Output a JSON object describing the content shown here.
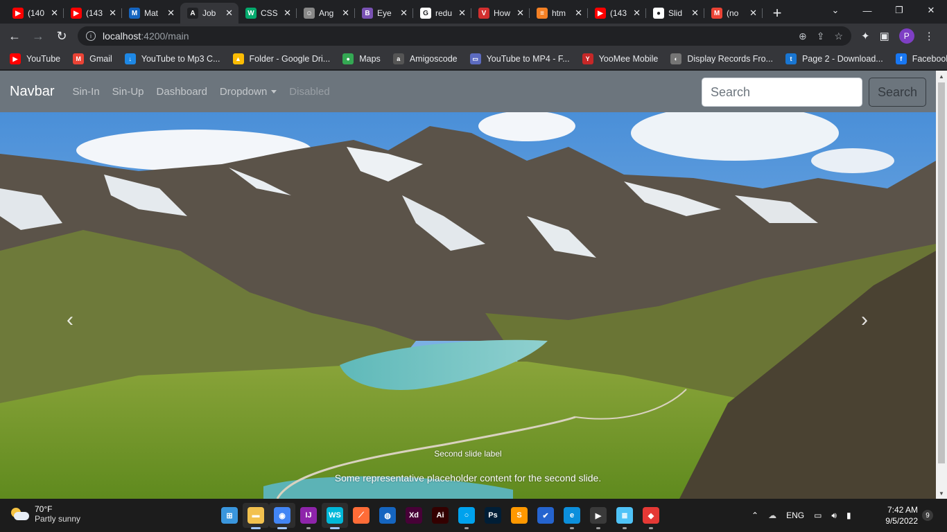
{
  "browser": {
    "tabs": [
      {
        "title": "(140",
        "icon": "youtube-icon",
        "color": "#ff0000",
        "glyph": "▶"
      },
      {
        "title": "(143",
        "icon": "youtube-icon",
        "color": "#ff0000",
        "glyph": "▶"
      },
      {
        "title": "Mat",
        "icon": "materialize-icon",
        "color": "#1565c0",
        "glyph": "M"
      },
      {
        "title": "Job",
        "icon": "angular-icon",
        "color": "#202124",
        "glyph": "A"
      },
      {
        "title": "CSS",
        "icon": "w3schools-icon",
        "color": "#04aa6d",
        "glyph": "W"
      },
      {
        "title": "Ang",
        "icon": "avatar-icon",
        "color": "#888888",
        "glyph": "☺"
      },
      {
        "title": "Eye",
        "icon": "bootstrap-icon",
        "color": "#7952b3",
        "glyph": "B"
      },
      {
        "title": "redu",
        "icon": "google-icon",
        "color": "#ffffff",
        "glyph": "G"
      },
      {
        "title": "How",
        "icon": "vivaldi-icon",
        "color": "#d32f2f",
        "glyph": "V"
      },
      {
        "title": "htm",
        "icon": "stackoverflow-icon",
        "color": "#f48024",
        "glyph": "≡"
      },
      {
        "title": "(143",
        "icon": "youtube-icon",
        "color": "#ff0000",
        "glyph": "▶"
      },
      {
        "title": "Slid",
        "icon": "github-icon",
        "color": "#ffffff",
        "glyph": "●"
      },
      {
        "title": "(no",
        "icon": "gmail-icon",
        "color": "#ea4335",
        "glyph": "M"
      }
    ],
    "active_tab": 3,
    "url_host": "localhost",
    "url_path": ":4200/main",
    "bookmarks": [
      {
        "label": "YouTube",
        "icon": "youtube-icon",
        "color": "#ff0000",
        "glyph": "▶"
      },
      {
        "label": "Gmail",
        "icon": "gmail-icon",
        "color": "#ea4335",
        "glyph": "M"
      },
      {
        "label": "YouTube to Mp3 C...",
        "icon": "download-icon",
        "color": "#1e88e5",
        "glyph": "↓"
      },
      {
        "label": "Folder - Google Dri...",
        "icon": "google-drive-icon",
        "color": "#fbbc04",
        "glyph": "▲"
      },
      {
        "label": "Maps",
        "icon": "maps-icon",
        "color": "#34a853",
        "glyph": "●"
      },
      {
        "label": "Amigoscode",
        "icon": "amigoscode-icon",
        "color": "#555555",
        "glyph": "a"
      },
      {
        "label": "YouTube to MP4 - F...",
        "icon": "converter-icon",
        "color": "#5c6bc0",
        "glyph": "▭"
      },
      {
        "label": "YooMee Mobile",
        "icon": "yoomee-icon",
        "color": "#c62828",
        "glyph": "Y"
      },
      {
        "label": "Display Records Fro...",
        "icon": "globe-icon",
        "color": "#757575",
        "glyph": "◐"
      },
      {
        "label": "Page 2 - Download...",
        "icon": "page-icon",
        "color": "#1976d2",
        "glyph": "t"
      },
      {
        "label": "Facebook",
        "icon": "facebook-icon",
        "color": "#1877f2",
        "glyph": "f"
      }
    ],
    "bookmarks_more": "»",
    "profile_initial": "P"
  },
  "page": {
    "navbar": {
      "brand": "Navbar",
      "links": [
        "Sin-In",
        "Sin-Up",
        "Dashboard"
      ],
      "dropdown": "Dropdown",
      "disabled": "Disabled",
      "search_placeholder": "Search",
      "search_button": "Search"
    },
    "carousel": {
      "slide_label": "Second slide label",
      "slide_text": "Some representative placeholder content for the second slide.",
      "prev_glyph": "‹",
      "next_glyph": "›"
    }
  },
  "taskbar": {
    "weather_temp": "70°F",
    "weather_condition": "Partly sunny",
    "language": "ENG",
    "time": "7:42 AM",
    "date": "9/5/2022",
    "notification_count": "9",
    "apps": [
      {
        "name": "start-icon",
        "color": "#3a96dd",
        "glyph": "⊞",
        "running": false
      },
      {
        "name": "file-explorer-icon",
        "color": "#f2c14e",
        "glyph": "▬",
        "running": true
      },
      {
        "name": "chrome-icon",
        "color": "#4285f4",
        "glyph": "◉",
        "running": true
      },
      {
        "name": "intellij-icon",
        "color": "#8e24aa",
        "glyph": "IJ",
        "running": false
      },
      {
        "name": "webstorm-icon",
        "color": "#00b8d9",
        "glyph": "WS",
        "running": true
      },
      {
        "name": "postman-icon",
        "color": "#ff6c37",
        "glyph": "⟋",
        "running": false
      },
      {
        "name": "app-icon",
        "color": "#1565c0",
        "glyph": "◍",
        "running": false
      },
      {
        "name": "adobe-xd-icon",
        "color": "#470137",
        "glyph": "Xd",
        "running": false
      },
      {
        "name": "illustrator-icon",
        "color": "#330000",
        "glyph": "Ai",
        "running": false
      },
      {
        "name": "cortana-icon",
        "color": "#00a2ed",
        "glyph": "○",
        "running": false
      },
      {
        "name": "photoshop-icon",
        "color": "#001e36",
        "glyph": "Ps",
        "running": false
      },
      {
        "name": "sublime-icon",
        "color": "#ff9800",
        "glyph": "S",
        "running": false
      },
      {
        "name": "todo-icon",
        "color": "#2564cf",
        "glyph": "✔",
        "running": false
      },
      {
        "name": "edge-icon",
        "color": "#0c8fdc",
        "glyph": "e",
        "running": false
      },
      {
        "name": "media-player-icon",
        "color": "#3a3a3a",
        "glyph": "▶",
        "running": false
      },
      {
        "name": "notepad-icon",
        "color": "#4fc3f7",
        "glyph": "≣",
        "running": false
      },
      {
        "name": "git-icon",
        "color": "#e53935",
        "glyph": "◆",
        "running": false
      }
    ]
  }
}
